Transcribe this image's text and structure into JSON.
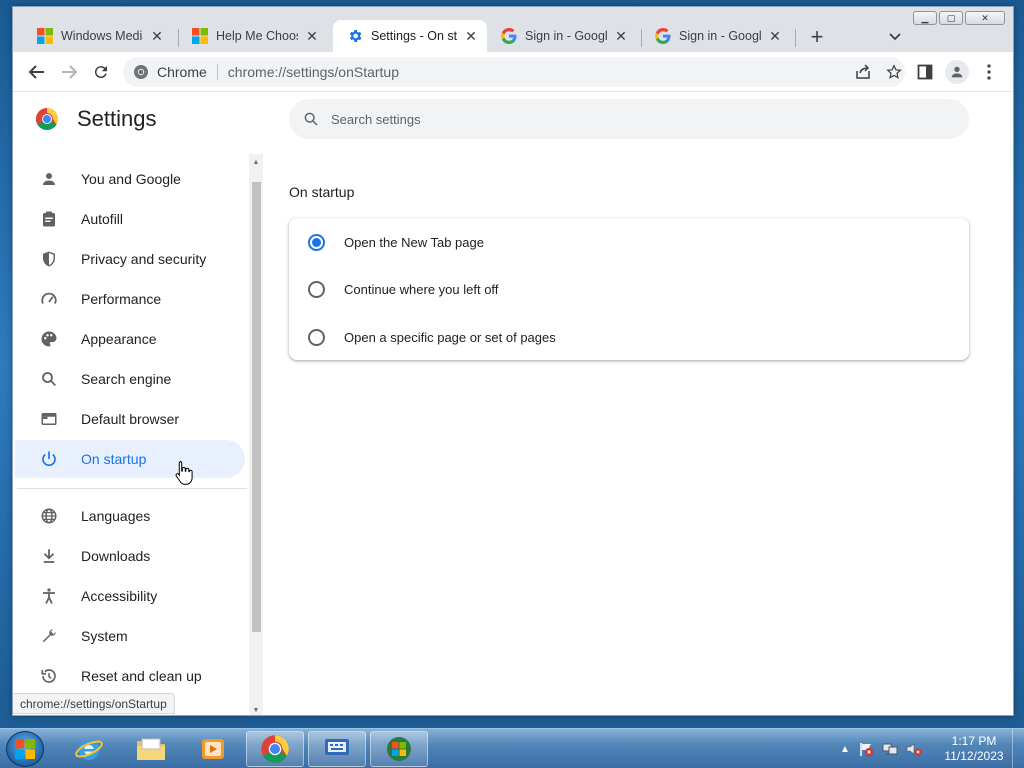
{
  "browser": {
    "tabs": [
      {
        "title": "Windows Media",
        "favicon": "windows-logo-icon",
        "active": false
      },
      {
        "title": "Help Me Choose",
        "favicon": "windows-logo-icon",
        "active": false
      },
      {
        "title": "Settings - On sta",
        "favicon": "gear-icon",
        "active": true
      },
      {
        "title": "Sign in - Google",
        "favicon": "google-g-icon",
        "active": false
      },
      {
        "title": "Sign in - Google",
        "favicon": "google-g-icon",
        "active": false
      }
    ],
    "omnibox": {
      "site_label": "Chrome",
      "url": "chrome://settings/onStartup"
    }
  },
  "settings": {
    "title": "Settings",
    "search_placeholder": "Search settings",
    "nav": [
      {
        "label": "You and Google",
        "icon": "person-icon",
        "active": false
      },
      {
        "label": "Autofill",
        "icon": "clipboard-icon",
        "active": false
      },
      {
        "label": "Privacy and security",
        "icon": "shield-icon",
        "active": false
      },
      {
        "label": "Performance",
        "icon": "gauge-icon",
        "active": false
      },
      {
        "label": "Appearance",
        "icon": "palette-icon",
        "active": false
      },
      {
        "label": "Search engine",
        "icon": "search-icon",
        "active": false
      },
      {
        "label": "Default browser",
        "icon": "browser-icon",
        "active": false
      },
      {
        "label": "On startup",
        "icon": "power-icon",
        "active": true
      },
      {
        "label": "Languages",
        "icon": "globe-icon",
        "active": false
      },
      {
        "label": "Downloads",
        "icon": "download-icon",
        "active": false
      },
      {
        "label": "Accessibility",
        "icon": "accessibility-icon",
        "active": false
      },
      {
        "label": "System",
        "icon": "wrench-icon",
        "active": false
      },
      {
        "label": "Reset and clean up",
        "icon": "history-icon",
        "active": false
      }
    ],
    "section_title": "On startup",
    "options": [
      {
        "label": "Open the New Tab page",
        "checked": true
      },
      {
        "label": "Continue where you left off",
        "checked": false
      },
      {
        "label": "Open a specific page or set of pages",
        "checked": false
      }
    ]
  },
  "status_bar": {
    "text": "chrome://settings/onStartup"
  },
  "taskbar": {
    "time": "1:17 PM",
    "date": "11/12/2023"
  },
  "colors": {
    "accent": "#1a73e8",
    "active_nav_bg": "#e8f0fe"
  }
}
